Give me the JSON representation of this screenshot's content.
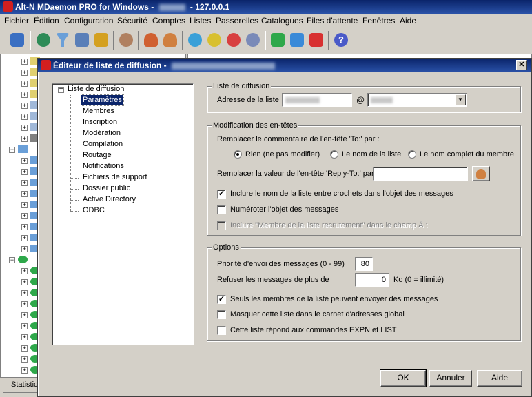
{
  "main_window": {
    "title_prefix": "Alt-N MDaemon PRO for Windows -",
    "title_suffix": "- 127.0.0.1"
  },
  "menu": [
    "Fichier",
    "Édition",
    "Configuration",
    "Sécurité",
    "Comptes",
    "Listes",
    "Passerelles",
    "Catalogues",
    "Files d'attente",
    "Fenêtres",
    "Aide"
  ],
  "toolbar_icons": [
    "network-icon",
    "antispam-icon",
    "filter-icon",
    "security-scan-icon",
    "lock-icon",
    "search-user-icon",
    "account-icon",
    "accounts-icon",
    "queue-cycle-icon-1",
    "queue-cycle-icon-2",
    "queue-cycle-icon-3",
    "queue-cycle-icon-4",
    "green-button-icon",
    "blue-button-icon",
    "red-button-icon",
    "help-icon"
  ],
  "status_tab": "Statistiques",
  "dialog": {
    "title": "Éditeur de liste de diffusion -",
    "close_label": "✕",
    "tree": {
      "root": "Liste de diffusion",
      "items": [
        "Paramètres",
        "Membres",
        "Inscription",
        "Modération",
        "Compilation",
        "Routage",
        "Notifications",
        "Fichiers de support",
        "Dossier public",
        "Active Directory",
        "ODBC"
      ],
      "selected": "Paramètres"
    },
    "list_group": {
      "legend": "Liste de diffusion",
      "address_label": "Adresse de la liste",
      "at": "@"
    },
    "headers_group": {
      "legend": "Modification des en-têtes",
      "to_label": "Remplacer le commentaire de l'en-tête 'To:' par :",
      "radio_none": "Rien (ne pas modifier)",
      "radio_list_name": "Le nom de la liste",
      "radio_full_name": "Le nom complet du membre",
      "reply_to_label": "Remplacer la valeur de l'en-tête 'Reply-To:' par",
      "reply_to_value": "",
      "chk_brackets": "Inclure le nom de la liste entre crochets dans l'objet des messages",
      "chk_number": "Numéroter l'objet des messages",
      "chk_member": "Inclure \"Membre de la liste recrutement\" dans le champ À :"
    },
    "options_group": {
      "legend": "Options",
      "priority_label": "Priorité d'envoi des messages (0 - 99)",
      "priority_value": "80",
      "refuse_label": "Refuser les messages de plus de",
      "refuse_value": "0",
      "refuse_unit": "Ko (0 = illimité)",
      "chk_members_only": "Seuls les membres de la liste peuvent envoyer des messages",
      "chk_hide": "Masquer cette liste dans le carnet d'adresses global",
      "chk_expn": "Cette liste répond aux commandes EXPN et LIST"
    },
    "buttons": {
      "ok": "OK",
      "cancel": "Annuler",
      "help": "Aide"
    },
    "state": {
      "radio_selected": "none",
      "chk_brackets": true,
      "chk_number": false,
      "chk_member": false,
      "chk_members_only": true,
      "chk_hide": false,
      "chk_expn": false
    }
  }
}
